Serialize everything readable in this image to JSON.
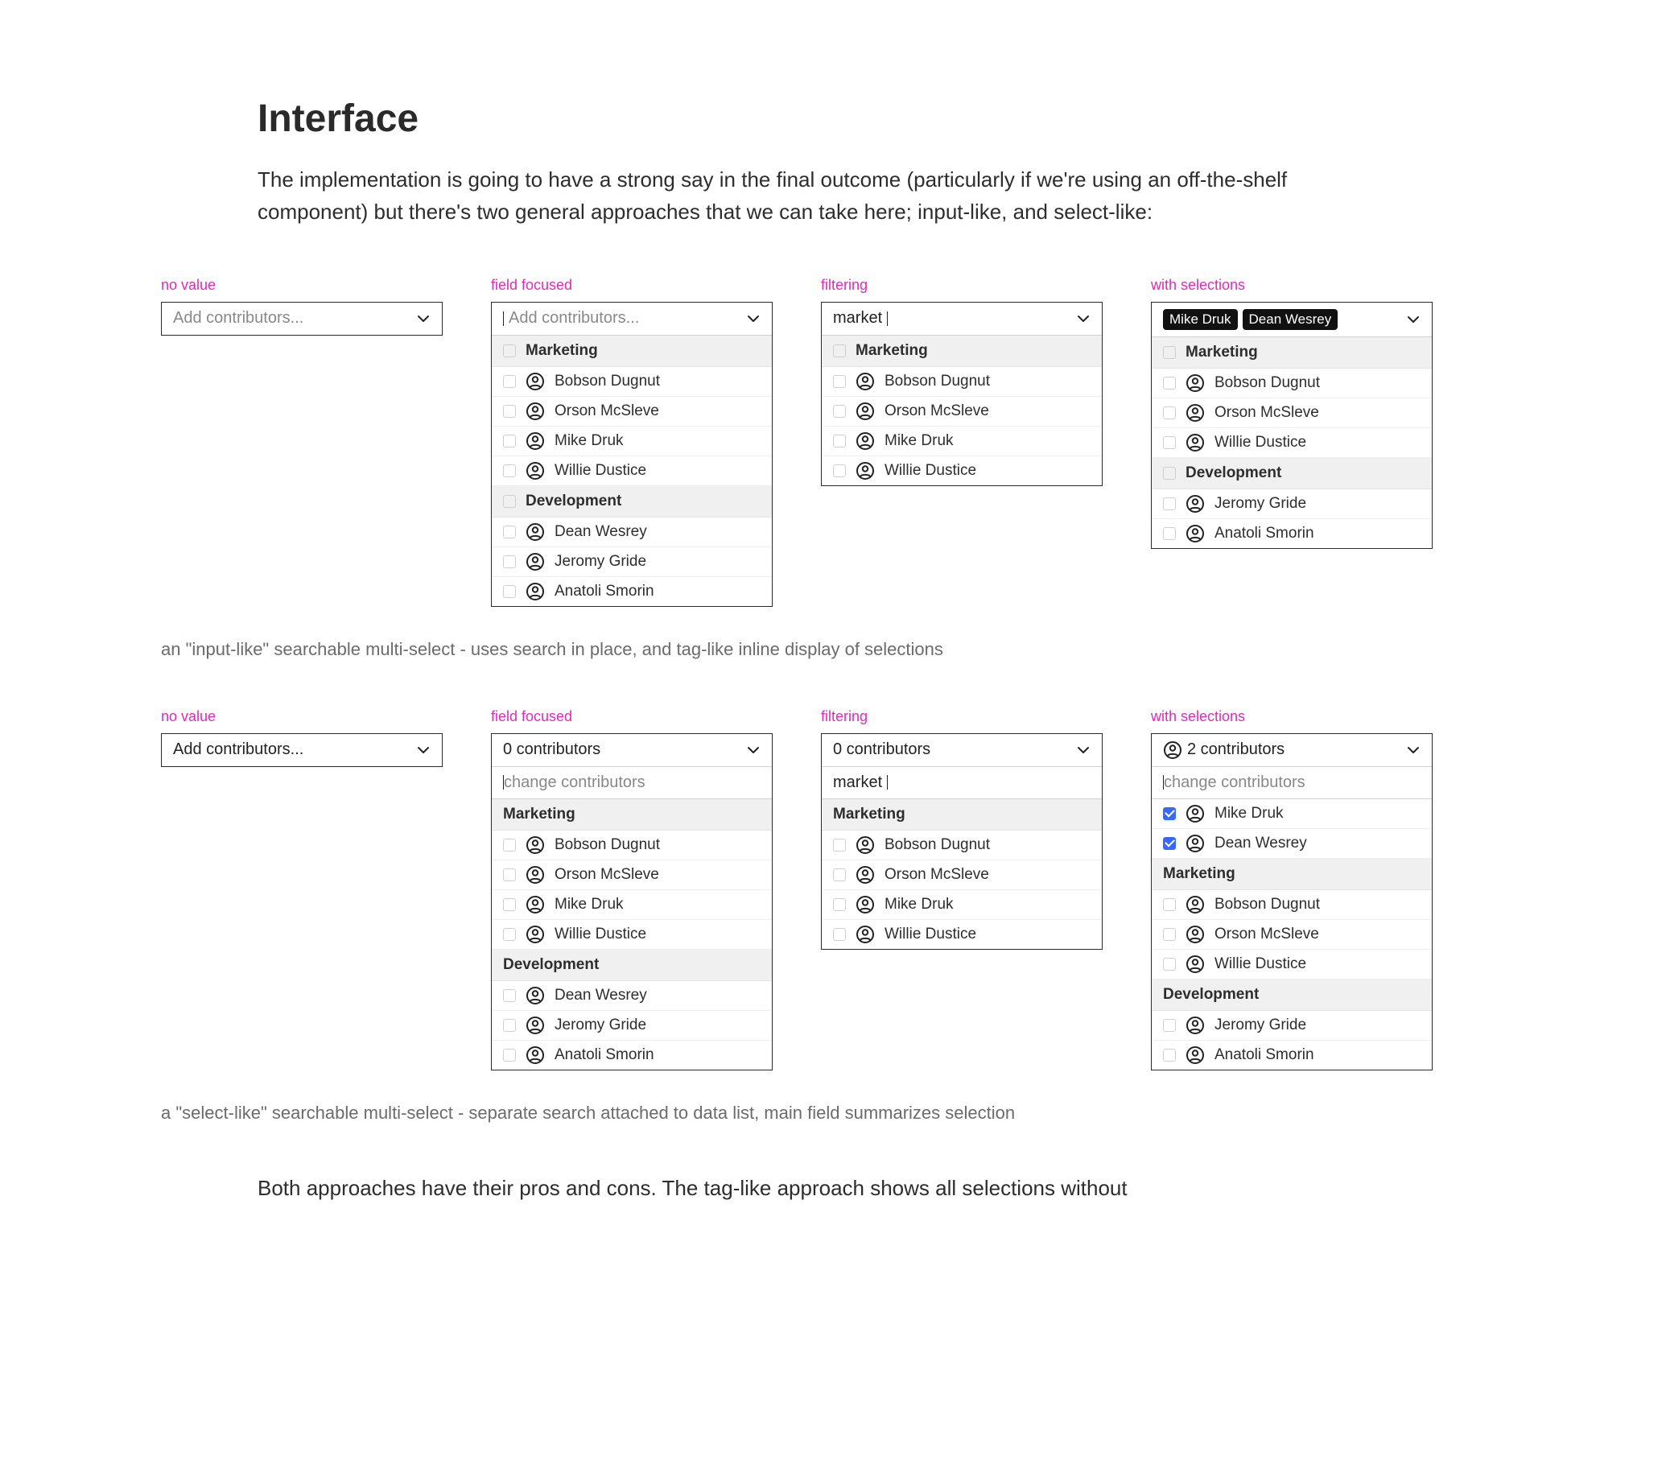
{
  "heading": "Interface",
  "lead": "The implementation is going to have a strong say in the final outcome (particularly if we're using an off-the-shelf component) but there's two general approaches that we can take here; input-like, and select-like:",
  "state_labels": {
    "no_value": "no value",
    "field_focused": "field focused",
    "filtering": "filtering",
    "with_selections": "with selections"
  },
  "placeholders": {
    "add": "Add contributors...",
    "change": "change contributors"
  },
  "filter_value": "market",
  "groups": {
    "marketing": "Marketing",
    "development": "Development"
  },
  "people": {
    "bobson": "Bobson Dugnut",
    "orson": "Orson McSleve",
    "mike": "Mike Druk",
    "willie": "Willie Dustice",
    "dean": "Dean Wesrey",
    "jeromy": "Jeromy Gride",
    "anatoli": "Anatoli Smorin"
  },
  "summary": {
    "zero": "0 contributors",
    "two": "2 contributors"
  },
  "caption_input": "an \"input-like\" searchable multi-select - uses search in place, and tag-like inline display of selections",
  "caption_select": "a \"select-like\" searchable multi-select - separate search attached to data list, main field summarizes selection",
  "closing": "Both approaches have their pros and cons. The tag-like approach shows all selections without"
}
